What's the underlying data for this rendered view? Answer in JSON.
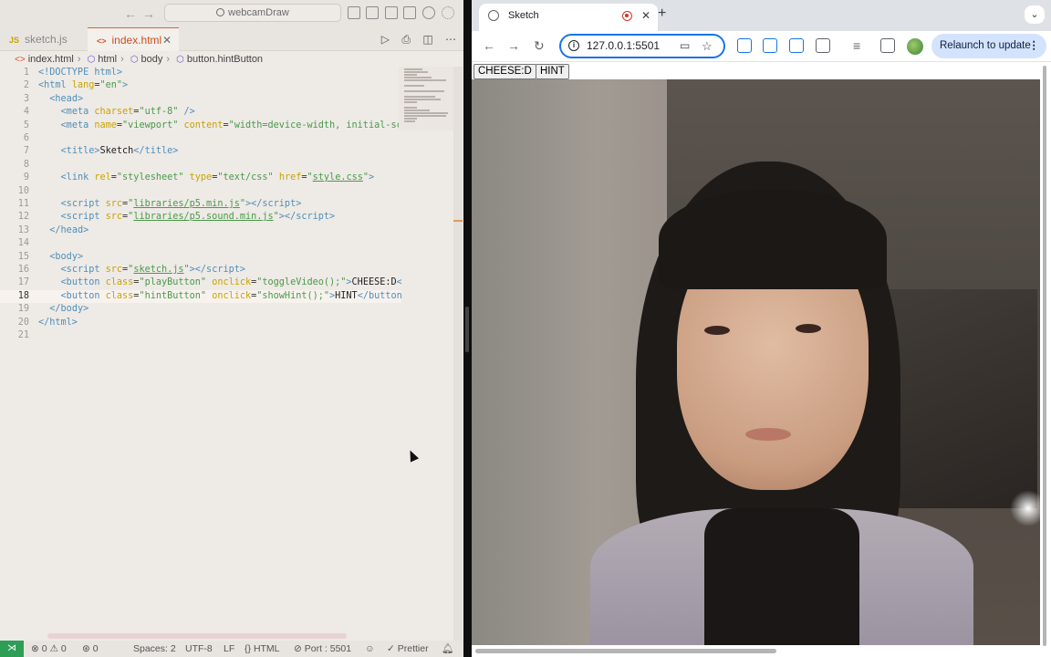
{
  "vscode": {
    "command_center": "webcamDraw",
    "tabs": [
      {
        "label": "sketch.js",
        "type": "JS"
      },
      {
        "label": "index.html",
        "type": "<>"
      }
    ],
    "breadcrumb": [
      "index.html",
      "html",
      "body",
      "button.hintButton"
    ],
    "lines": [
      {
        "n": "1",
        "html": "<span class='tg'>&lt;!DOCTYPE html&gt;</span>"
      },
      {
        "n": "2",
        "html": "<span class='tg'>&lt;html</span> <span class='at'>lang</span>=<span class='st'>\"en\"</span><span class='tg'>&gt;</span>"
      },
      {
        "n": "3",
        "html": "  <span class='tg'>&lt;head&gt;</span>"
      },
      {
        "n": "4",
        "html": "    <span class='tg'>&lt;meta</span> <span class='at'>charset</span>=<span class='st'>\"utf-8\"</span> <span class='tg'>/&gt;</span>"
      },
      {
        "n": "5",
        "html": "    <span class='tg'>&lt;meta</span> <span class='at'>name</span>=<span class='st'>\"viewport\"</span> <span class='at'>content</span>=<span class='st'>\"width=device-width, initial-sca</span>"
      },
      {
        "n": "6",
        "html": ""
      },
      {
        "n": "7",
        "html": "    <span class='tg'>&lt;title&gt;</span><span class='tx'>Sketch</span><span class='tg'>&lt;/title&gt;</span>"
      },
      {
        "n": "8",
        "html": ""
      },
      {
        "n": "9",
        "html": "    <span class='tg'>&lt;link</span> <span class='at'>rel</span>=<span class='st'>\"stylesheet\"</span> <span class='at'>type</span>=<span class='st'>\"text/css\"</span> <span class='at'>href</span>=<span class='st'>\"<span class='lk'>style.css</span>\"</span><span class='tg'>&gt;</span>"
      },
      {
        "n": "10",
        "html": ""
      },
      {
        "n": "11",
        "html": "    <span class='tg'>&lt;script</span> <span class='at'>src</span>=<span class='st'>\"<span class='lk'>libraries/p5.min.js</span>\"</span><span class='tg'>&gt;&lt;/script&gt;</span>"
      },
      {
        "n": "12",
        "html": "    <span class='tg'>&lt;script</span> <span class='at'>src</span>=<span class='st'>\"<span class='lk'>libraries/p5.sound.min.js</span>\"</span><span class='tg'>&gt;&lt;/script&gt;</span>"
      },
      {
        "n": "13",
        "html": "  <span class='tg'>&lt;/head&gt;</span>"
      },
      {
        "n": "14",
        "html": ""
      },
      {
        "n": "15",
        "html": "  <span class='tg'>&lt;body&gt;</span>"
      },
      {
        "n": "16",
        "html": "    <span class='tg'>&lt;script</span> <span class='at'>src</span>=<span class='st'>\"<span class='lk'>sketch.js</span>\"</span><span class='tg'>&gt;&lt;/script&gt;</span>"
      },
      {
        "n": "17",
        "html": "    <span class='tg'>&lt;button</span> <span class='at'>class</span>=<span class='st'>\"playButton\"</span> <span class='at'>onclick</span>=<span class='st'>\"toggleVideo();\"</span><span class='tg'>&gt;</span><span class='tx'>CHEESE:D</span><span class='tg'>&lt;/</span>"
      },
      {
        "n": "18",
        "html": "    <span class='tg'>&lt;button</span> <span class='at'>class</span>=<span class='st'>\"hintButton\"</span> <span class='at'>onclick</span>=<span class='st'>\"showHint();\"</span><span class='tg'>&gt;</span><span class='tx'>HINT</span><span class='tg'>&lt;/button&gt;</span>"
      },
      {
        "n": "19",
        "html": "  <span class='tg'>&lt;/body&gt;</span>"
      },
      {
        "n": "20",
        "html": "<span class='tg'>&lt;/html&gt;</span>"
      },
      {
        "n": "21",
        "html": ""
      }
    ],
    "status": {
      "errors": "0",
      "warnings": "0",
      "ports": "0",
      "spaces": "Spaces: 2",
      "encoding": "UTF-8",
      "eol": "LF",
      "language": "HTML",
      "port": "Port : 5501",
      "formatter": "Prettier"
    }
  },
  "chrome": {
    "tab_title": "Sketch",
    "url": "127.0.0.1:5501",
    "relaunch": "Relaunch to update",
    "page_buttons": [
      "CHEESE:D",
      "HINT"
    ]
  }
}
